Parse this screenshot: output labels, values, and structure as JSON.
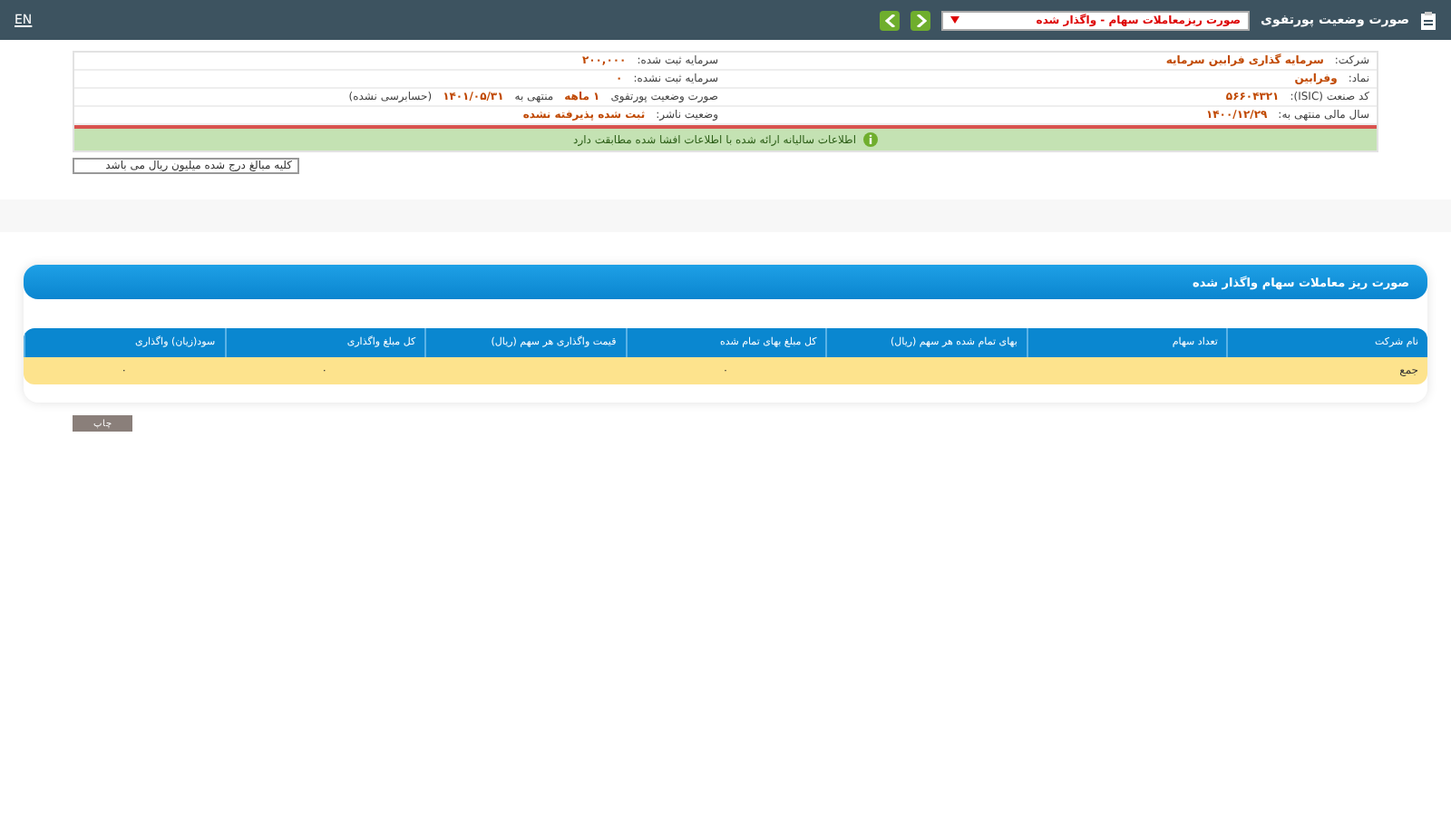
{
  "header": {
    "title": "صورت وضعیت پورتفوی",
    "report_select": "صورت ریزمعاملات سهام - واگذار شده",
    "language": "EN"
  },
  "info": {
    "right": [
      {
        "label": "شرکت:",
        "value": "سرمایه گذاری فرابین سرمایه"
      },
      {
        "label": "نماد:",
        "value": "وفرابین"
      },
      {
        "label": "کد صنعت (ISIC):",
        "value": "۵۶۶۰۴۳۲۱"
      },
      {
        "label": "سال مالی منتهی به:",
        "value": "۱۴۰۰/۱۲/۲۹"
      }
    ],
    "capital": [
      {
        "label": "سرمایه ثبت شده:",
        "value": "۲۰۰,۰۰۰"
      },
      {
        "label": "سرمایه ثبت نشده:",
        "value": "۰"
      }
    ],
    "period": {
      "label": "صورت وضعیت پورتفوی",
      "months": "۱ ماهه",
      "to": "منتهی به",
      "date": "۱۴۰۱/۰۵/۳۱",
      "audit": "(حسابرسی نشده)"
    },
    "status": {
      "label": "وضعیت ناشر:",
      "value": "ثبت شده پذیرفته نشده"
    },
    "notice": "اطلاعات سالیانه ارائه شده با اطلاعات افشا شده مطابقت دارد"
  },
  "unit_note": "کلیه مبالغ درج شده میلیون ریال می باشد",
  "section": {
    "title": "صورت ریز معاملات سهام واگذار شده",
    "columns": [
      "نام شرکت",
      "تعداد سهام",
      "بهای تمام شده هر سهم (ریال)",
      "کل مبلغ بهای تمام شده",
      "قیمت واگذاری هر سهم (ریال)",
      "کل مبلغ واگذاری",
      "سود(زیان) واگذاری"
    ],
    "total_row": {
      "name": "جمع",
      "total_cost": "۰",
      "total_sale": "۰",
      "profit": "۰"
    }
  },
  "print_button": "چاپ"
}
